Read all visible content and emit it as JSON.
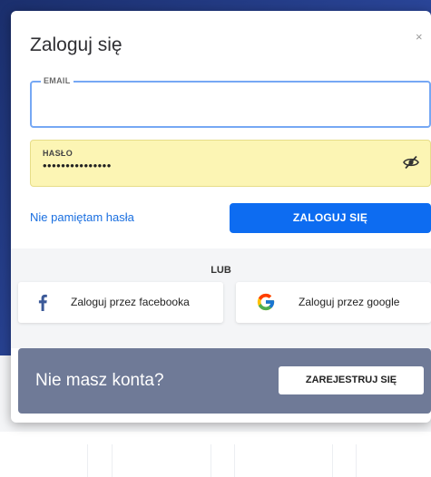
{
  "modal": {
    "title": "Zaloguj się",
    "close_glyph": "×"
  },
  "form": {
    "email": {
      "label": "EMAIL",
      "value": "",
      "placeholder": ""
    },
    "password": {
      "label": "HASŁO",
      "masked_value": "•••••••••••••••",
      "toggle_icon": "eye-slash-icon"
    },
    "forgot_link": "Nie pamiętam hasła",
    "login_button": "ZALOGUJ SIĘ"
  },
  "social": {
    "divider": "LUB",
    "facebook": {
      "label": "Zaloguj przez facebooka",
      "icon": "facebook-icon",
      "color": "#3b5998"
    },
    "google": {
      "label": "Zaloguj przez google",
      "icon": "google-icon"
    }
  },
  "register": {
    "prompt": "Nie masz konta?",
    "button": "ZAREJESTRUJ SIĘ"
  },
  "colors": {
    "primary": "#0d6cf1",
    "link": "#1a6fe0",
    "autofill": "#fcf5b4",
    "register_bg": "#6f7a97",
    "backdrop": "#2a4598"
  }
}
